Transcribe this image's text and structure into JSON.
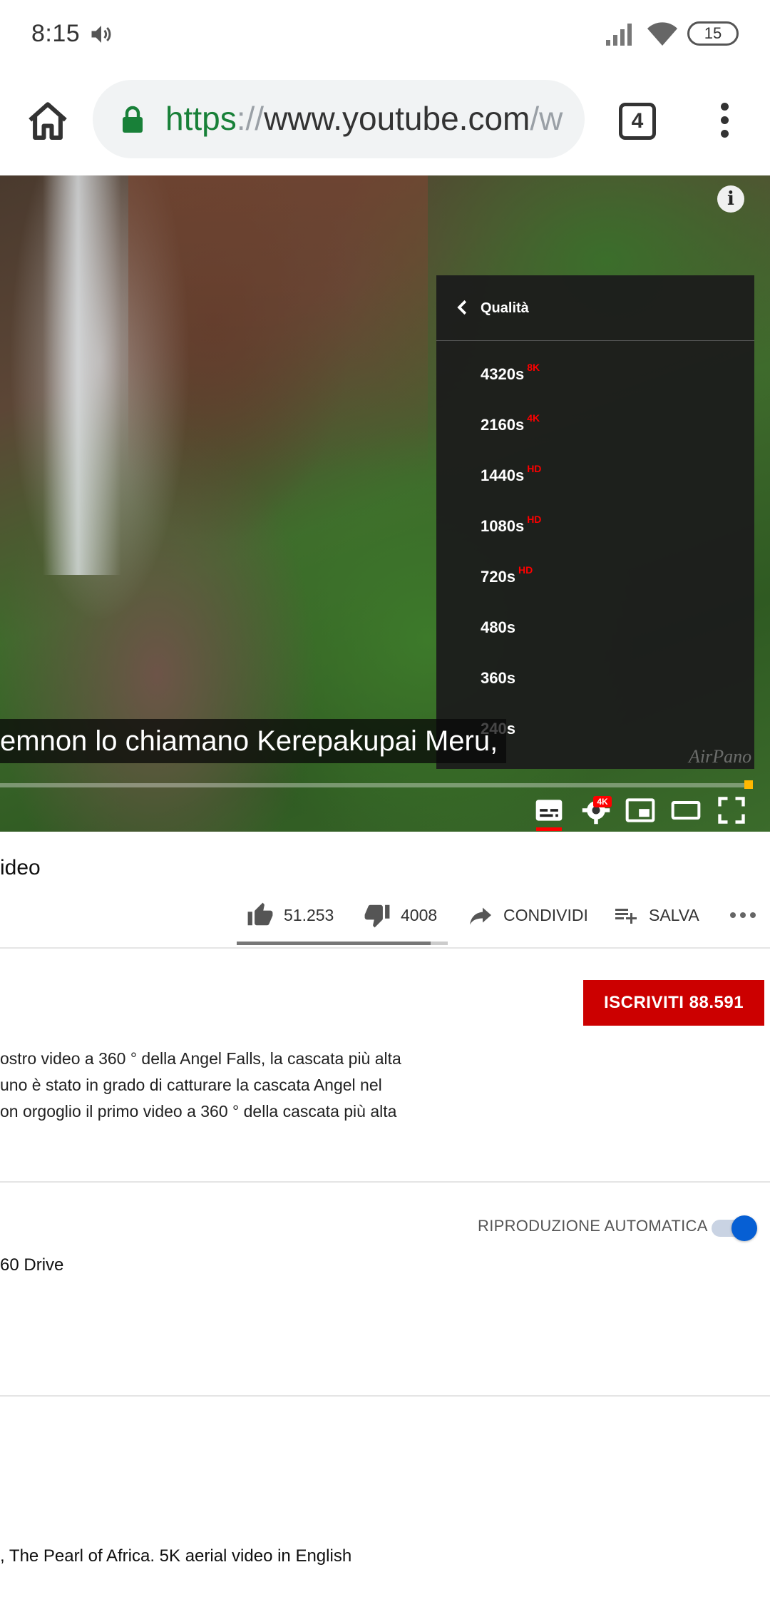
{
  "status_bar": {
    "time": "8:15",
    "battery": "15"
  },
  "browser": {
    "url_scheme": "https",
    "url_sep": "://",
    "url_host": "www.youtube.com",
    "url_rest": "/w",
    "tab_count": "4"
  },
  "player": {
    "caption": "emnon lo chiamano Kerepakupai Meru,",
    "watermark": "AirPano",
    "hd_badge": "4K",
    "quality_menu": {
      "title": "Qualità",
      "options": [
        {
          "label": "4320s",
          "badge": "8K"
        },
        {
          "label": "2160s",
          "badge": "4K"
        },
        {
          "label": "1440s",
          "badge": "HD"
        },
        {
          "label": "1080s",
          "badge": "HD"
        },
        {
          "label": "720s",
          "badge": "HD"
        },
        {
          "label": "480s",
          "badge": ""
        },
        {
          "label": "360s",
          "badge": ""
        },
        {
          "label": "240s",
          "badge": ""
        }
      ]
    }
  },
  "video": {
    "title": "ideo",
    "likes": "51.253",
    "dislikes": "4008",
    "share_label": "CONDIVIDI",
    "save_label": "SALVA",
    "subscribe_label": "ISCRIVITI  88.591",
    "description": [
      "ostro video a 360 ° della Angel Falls, la cascata più alta",
      "uno è stato in grado di catturare la cascata Angel nel",
      "on orgoglio il primo video a 360 ° della cascata più alta"
    ]
  },
  "up_next": {
    "autoplay_label": "RIPRODUZIONE AUTOMATICA",
    "autoplay_on": true,
    "next_title": "60 Drive",
    "recommended_title": ", The Pearl of Africa. 5K aerial video in English"
  },
  "colors": {
    "accent_red": "#cc0000",
    "toggle_blue": "#065fd4",
    "url_green": "#188038"
  }
}
